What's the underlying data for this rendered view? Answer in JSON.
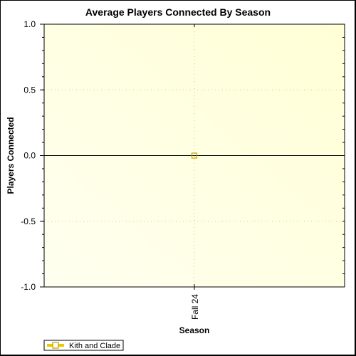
{
  "chart_data": {
    "type": "line",
    "title": "Average Players Connected By Season",
    "xlabel": "Season",
    "ylabel": "Players Connected",
    "categories": [
      "Fall 24"
    ],
    "series": [
      {
        "name": "Kith and Clade",
        "values": [
          0
        ],
        "color": "#c8a000",
        "marker": "square-hollow"
      }
    ],
    "ylim": [
      -1.0,
      1.0
    ],
    "yticks": [
      1.0,
      0.5,
      0.0,
      -0.5,
      -1.0
    ],
    "ytick_labels": [
      "1.0",
      "0.5",
      "0.0",
      "-0.5",
      "-1.0"
    ],
    "y_minor_step": 0.1,
    "grid": true,
    "legend": "bottom-left",
    "plot_background": "#fffde0",
    "zero_line_color": "#000000"
  }
}
